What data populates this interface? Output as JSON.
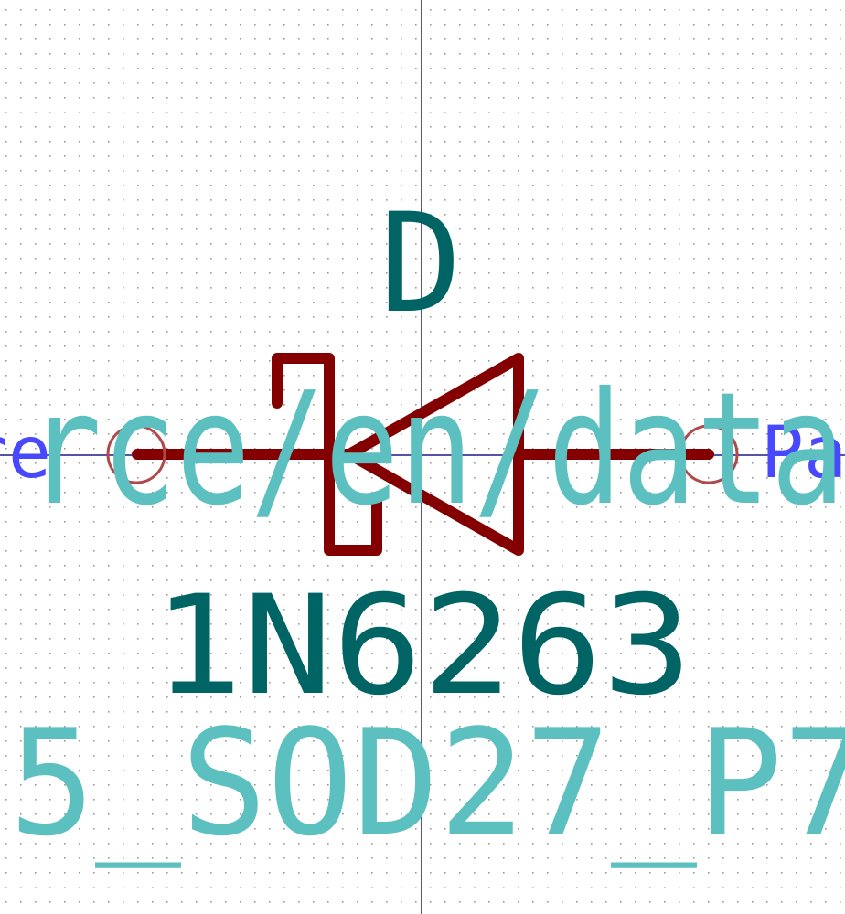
{
  "symbol": {
    "reference": "D",
    "value": "1N6263",
    "footprint_fragment": "5_SOD27_P7",
    "datasheet_fragment": "rce/en/data",
    "pin_label_left": "re",
    "pin_label_right": "Pa"
  },
  "colors": {
    "background": "#ffffff",
    "grid_dot": "#9a9a9a",
    "crosshair": "#1a1a8c",
    "body": "#840000",
    "pin_marker": "#b04a4a",
    "reference_text": "#006464",
    "field_text": "#5cc0c0",
    "pin_label": "#4848ff"
  }
}
